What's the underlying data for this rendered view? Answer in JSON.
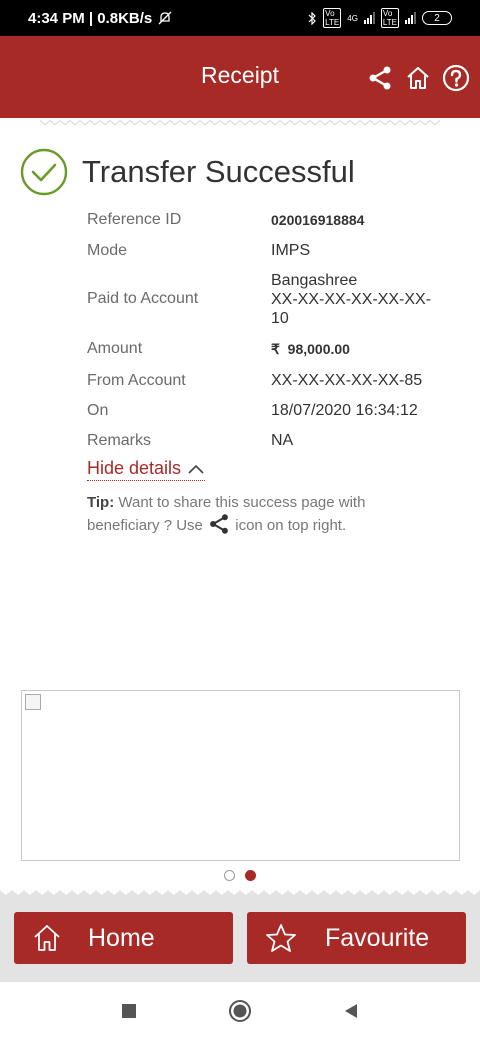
{
  "status_bar": {
    "time_speed": "4:34 PM | 0.8KB/s",
    "network": "4G",
    "battery": "2"
  },
  "header": {
    "title": "Receipt",
    "icons": [
      "share-icon",
      "home-icon",
      "help-icon"
    ]
  },
  "receipt": {
    "status_title": "Transfer Successful",
    "rows": [
      {
        "label": "Reference ID",
        "value": "020016918884"
      },
      {
        "label": "Mode",
        "value": "IMPS"
      },
      {
        "label": "Paid to Account",
        "value": "Bangashree\nXX-XX-XX-XX-XX-XX-\n10"
      },
      {
        "label": "Amount",
        "value": "₹  98,000.00"
      },
      {
        "label": "From Account",
        "value": "XX-XX-XX-XX-XX-85"
      },
      {
        "label": "On",
        "value": "18/07/2020 16:34:12"
      },
      {
        "label": "Remarks",
        "value": "NA"
      }
    ],
    "hide_details": "Hide details",
    "tip_label": "Tip:",
    "tip_text_1": " Want to share this success page with beneficiary ? Use ",
    "tip_text_2": " icon on top right."
  },
  "carousel": {
    "page_count": 2,
    "active_index": 1
  },
  "actions": {
    "home": "Home",
    "favourite": "Favourite"
  },
  "colors": {
    "brand": "#a72a26",
    "success": "#6a9a2a"
  }
}
